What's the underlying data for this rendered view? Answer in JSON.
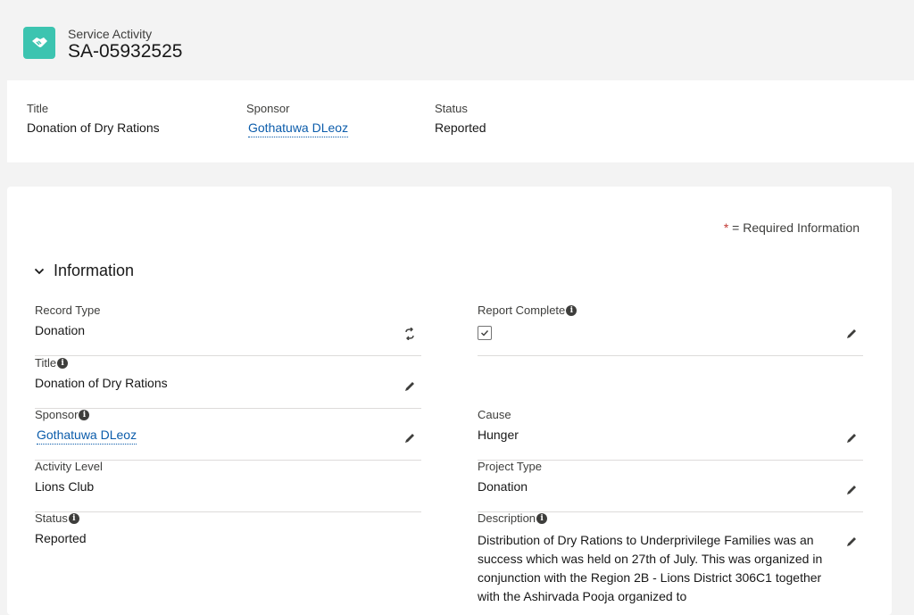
{
  "header": {
    "object_type": "Service Activity",
    "record_name": "SA-05932525",
    "icon": "handshake-icon",
    "icon_color": "#3cc4b0"
  },
  "highlights": {
    "title_label": "Title",
    "title_value": "Donation of Dry Rations",
    "sponsor_label": "Sponsor",
    "sponsor_value": "Gothatuwa DLeoz",
    "status_label": "Status",
    "status_value": "Reported"
  },
  "detail": {
    "required_star": "*",
    "required_text": " = Required Information",
    "section_title": "Information",
    "fields": {
      "record_type_label": "Record Type",
      "record_type_value": "Donation",
      "report_complete_label": "Report Complete",
      "report_complete_checked": true,
      "title_label": "Title",
      "title_value": "Donation of Dry Rations",
      "sponsor_label": "Sponsor",
      "sponsor_value": "Gothatuwa DLeoz",
      "cause_label": "Cause",
      "cause_value": "Hunger",
      "activity_level_label": "Activity Level",
      "activity_level_value": "Lions Club",
      "project_type_label": "Project Type",
      "project_type_value": "Donation",
      "status_label": "Status",
      "status_value": "Reported",
      "description_label": "Description",
      "description_value": "Distribution of Dry Rations to Underprivilege Families was an success which was held on 27th of July. This was organized in conjunction with the Region 2B - Lions District 306C1 together with the Ashirvada Pooja organized to"
    }
  },
  "colors": {
    "link": "#0b5cab",
    "background": "#f3f3f3",
    "required_star": "#c23934"
  }
}
